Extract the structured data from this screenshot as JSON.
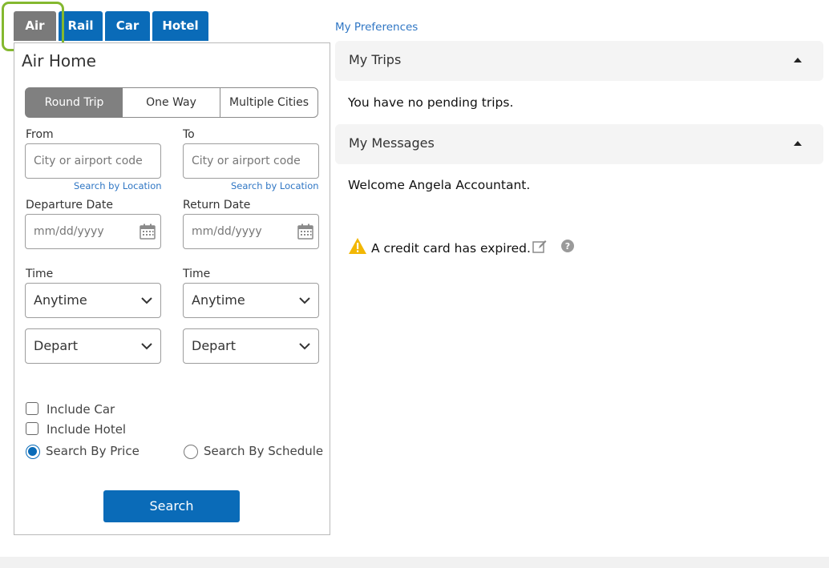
{
  "tabs": [
    {
      "label": "Air",
      "active": true
    },
    {
      "label": "Rail",
      "active": false
    },
    {
      "label": "Car",
      "active": false
    },
    {
      "label": "Hotel",
      "active": false
    }
  ],
  "panel": {
    "title": "Air Home",
    "trip_types": [
      "Round Trip",
      "One Way",
      "Multiple Cities"
    ],
    "from_label": "From",
    "to_label": "To",
    "from_placeholder": "City or airport code",
    "to_placeholder": "City or airport code",
    "search_by_location": "Search by Location",
    "departure_label": "Departure Date",
    "return_label": "Return Date",
    "date_placeholder": "mm/dd/yyyy",
    "time_label": "Time",
    "time_value": "Anytime",
    "depart_value": "Depart",
    "include_car": "Include Car",
    "include_hotel": "Include Hotel",
    "search_by_price": "Search By Price",
    "search_by_schedule": "Search By Schedule",
    "search_button": "Search"
  },
  "right": {
    "preferences_link": "My Preferences",
    "trips_header": "My Trips",
    "trips_text": "You have no pending trips.",
    "messages_header": "My Messages",
    "welcome_text": "Welcome Angela Accountant.",
    "alert_text": "A credit card has expired."
  },
  "colors": {
    "accent": "#0a6bb8",
    "focus_ring": "#84b82f",
    "warning": "#f2b705"
  }
}
